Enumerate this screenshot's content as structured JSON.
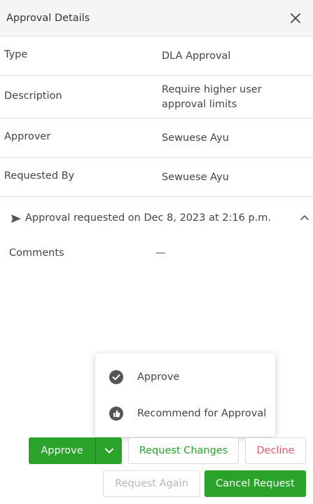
{
  "header": {
    "title": "Approval Details"
  },
  "details": [
    {
      "label": "Type",
      "value": "DLA Approval"
    },
    {
      "label": "Description",
      "value": "Require higher user approval limits"
    },
    {
      "label": "Approver",
      "value": "Sewuese Ayu"
    },
    {
      "label": "Requested By",
      "value": "Sewuese Ayu"
    }
  ],
  "activity": {
    "text": "Approval requested on Dec 8, 2023 at 2:16 p.m.",
    "comments_label": "Comments",
    "comments_value": "—"
  },
  "dropdown_menu": [
    {
      "label": "Approve",
      "icon": "check-circle-icon"
    },
    {
      "label": "Recommend for Approval",
      "icon": "thumbs-up-icon"
    }
  ],
  "actions": {
    "approve": "Approve",
    "request_changes": "Request Changes",
    "decline": "Decline",
    "request_again": "Request Again",
    "cancel_request": "Cancel Request"
  },
  "colors": {
    "primary_green": "#2aa32a",
    "danger_red": "#e85a68",
    "disabled_gray": "#b6b6b6"
  }
}
